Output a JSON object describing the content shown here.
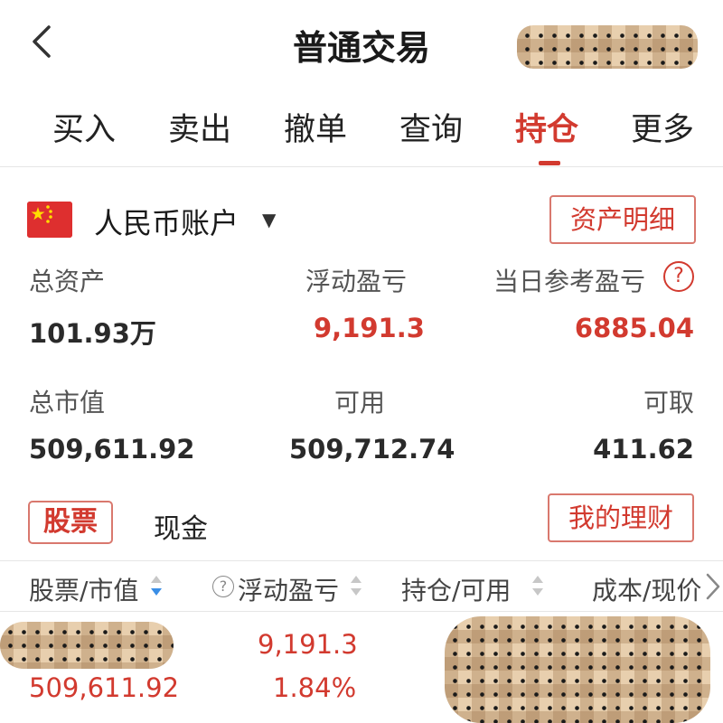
{
  "header": {
    "title": "普通交易"
  },
  "tabs": [
    {
      "label": "买入"
    },
    {
      "label": "卖出"
    },
    {
      "label": "撤单"
    },
    {
      "label": "查询"
    },
    {
      "label": "持仓",
      "active": true
    },
    {
      "label": "更多"
    }
  ],
  "account": {
    "name": "人民币账户",
    "dropdown_arrow": "▼",
    "asset_detail_label": "资产明细",
    "flag_icon": "china-flag-icon"
  },
  "summary": {
    "total_assets_label": "总资产",
    "total_assets_value": "101.93万",
    "floating_pl_label": "浮动盈亏",
    "floating_pl_value": "9,191.3",
    "daily_pl_label": "当日参考盈亏",
    "daily_pl_value": "6885.04",
    "help_glyph": "?",
    "market_value_label": "总市值",
    "market_value_value": "509,611.92",
    "available_label": "可用",
    "available_value": "509,712.74",
    "withdrawable_label": "可取",
    "withdrawable_value": "411.62"
  },
  "segments": {
    "stock_label": "股票",
    "cash_label": "现金",
    "finance_label": "我的理财"
  },
  "columns": {
    "stock_market_value": "股票/市值",
    "floating_pl": "浮动盈亏",
    "position_available": "持仓/可用",
    "cost_price": "成本/现价",
    "help_glyph": "?"
  },
  "positions": [
    {
      "market_value": "509,611.92",
      "floating_pl": "9,191.3",
      "floating_pl_pct": "1.84%"
    }
  ],
  "colors": {
    "accent_red": "#d23a2f",
    "sort_active_blue": "#3a8ee6"
  }
}
